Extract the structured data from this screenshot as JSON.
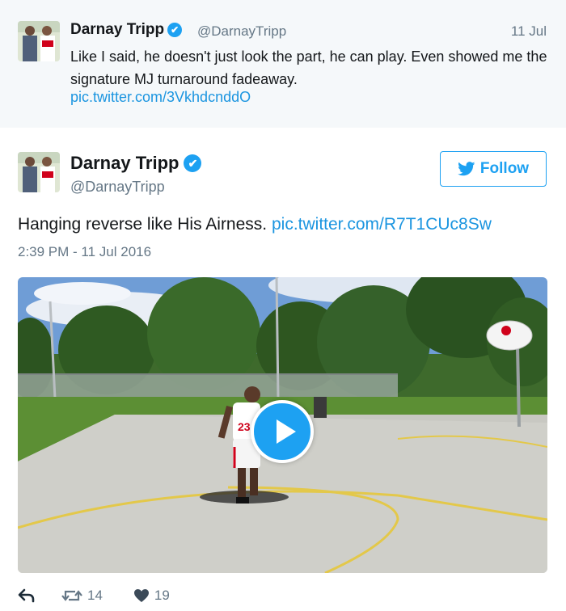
{
  "context_tweet": {
    "name": "Darnay Tripp",
    "handle": "@DarnayTripp",
    "date": "11 Jul",
    "text": "Like I said, he doesn't just look the part, he can play. Even showed me the signature MJ turnaround fadeaway.",
    "link": "pic.twitter.com/3VkhdcnddO"
  },
  "tweet": {
    "name": "Darnay Tripp",
    "handle": "@DarnayTripp",
    "follow_label": "Follow",
    "text": "Hanging reverse like His Airness.",
    "link": "pic.twitter.com/R7T1CUc8Sw",
    "timestamp": "2:39 PM - 11 Jul 2016",
    "jersey_number": "23",
    "actions": {
      "retweets": "14",
      "likes": "19"
    }
  },
  "colors": {
    "accent": "#1da1f2",
    "link": "#1b95e0",
    "muted": "#657786",
    "context_bg": "#f5f8fa"
  },
  "icons": [
    "verified-icon",
    "twitter-bird-icon",
    "play-icon",
    "reply-icon",
    "retweet-icon",
    "heart-icon"
  ]
}
